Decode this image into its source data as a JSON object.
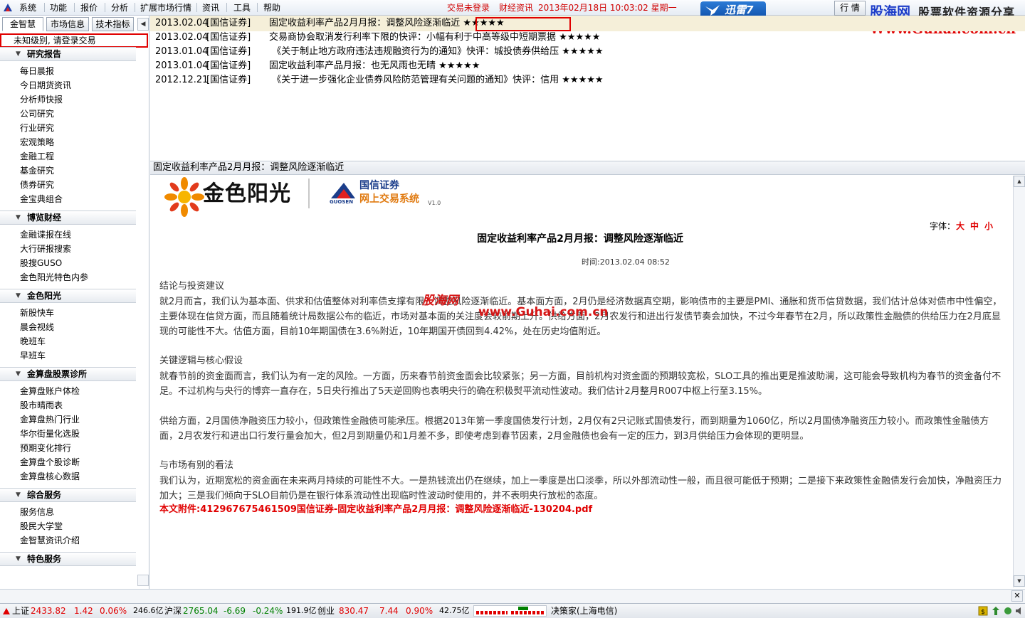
{
  "menubar": {
    "items": [
      "系统",
      "功能",
      "报价",
      "分析",
      "扩展市场行情",
      "资讯",
      "工具",
      "帮助"
    ],
    "login_status": "交易未登录",
    "fin_news": "财经资讯",
    "datetime": "2013年02月18日 10:03:02 星期一",
    "xunlei": "迅雷7",
    "hq_button": "行 情"
  },
  "watermark_top": {
    "site": "股海网",
    "slogan": "股票软件资源分享",
    "url": "Www.Guhai.com.cn"
  },
  "left_panel": {
    "tabs": [
      "金智慧",
      "市场信息",
      "技术指标"
    ],
    "login_prompt": "未知级别, 请登录交易",
    "sections": [
      {
        "title": "研究报告",
        "items": [
          "每日晨报",
          "今日期货资讯",
          "分析师快报",
          "公司研究",
          "行业研究",
          "宏观策略",
          "金融工程",
          "基金研究",
          "债券研究",
          "金宝典组合"
        ]
      },
      {
        "title": "博览财经",
        "items": [
          "金融谍报在线",
          "大行研报搜索",
          "股搜GUSO",
          "金色阳光特色内参"
        ]
      },
      {
        "title": "金色阳光",
        "items": [
          "新股快车",
          "晨会视线",
          "晚班车",
          "早班车"
        ]
      },
      {
        "title": "金算盘股票诊所",
        "items": [
          "金算盘账户体检",
          "股市晴雨表",
          "金算盘热门行业",
          "华尔街量化选股",
          "预期变化排行",
          "金算盘个股诊断",
          "金算盘核心数据"
        ]
      },
      {
        "title": "综合服务",
        "items": [
          "服务信息",
          "股民大学堂",
          "金智慧资讯介绍"
        ]
      },
      {
        "title": "特色服务",
        "items": []
      }
    ]
  },
  "news_list": [
    {
      "date": "2013.02.04",
      "source": "[国信证券]",
      "title": "固定收益利率产品2月月报：调整风险逐渐临近",
      "stars": "★★★★★"
    },
    {
      "date": "2013.02.04",
      "source": "[国信证券]",
      "title": "交易商协会取消发行利率下限的快评：小幅有利于中高等级中短期票据",
      "stars": "★★★★★"
    },
    {
      "date": "2013.01.04",
      "source": "[国信证券]",
      "title": " 《关于制止地方政府违法违规融资行为的通知》快评：城投债券供给压",
      "stars": "★★★★★"
    },
    {
      "date": "2013.01.04",
      "source": "[国信证券]",
      "title": "固定收益利率产品月报：也无风雨也无晴",
      "stars": "★★★★★"
    },
    {
      "date": "2012.12.21",
      "source": "[国信证券]",
      "title": " 《关于进一步强化企业债券风险防范管理有关问题的通知》快评：信用",
      "stars": "★★★★★"
    }
  ],
  "article": {
    "bar_title": "固定收益利率产品2月月报：调整风险逐渐临近",
    "brand": "金色阳光",
    "gs_name": "国信证券",
    "gs_en": "GUOSEN",
    "gs_system": "网上交易系统",
    "gs_version": "V1.0",
    "font_label": "字体：",
    "font_sizes": [
      "大",
      "中",
      "小"
    ],
    "title": "固定收益利率产品2月月报：调整风险逐渐临近",
    "time": "时间:2013.02.04 08:52",
    "sections": [
      {
        "head": "结论与投资建议",
        "text": "就2月而言，我们认为基本面、供求和估值整体对利率债支撑有限，调整风险逐渐临近。基本面方面，2月仍是经济数据真空期，影响债市的主要是PMI、通胀和货币信贷数据，我们估计总体对债市中性偏空，主要体现在信贷方面，而且随着统计局数据公布的临近，市场对基本面的关注度会较前期上升。供给方面，2月农发行和进出行发债节奏会加快，不过今年春节在2月，所以政策性金融债的供给压力在2月底显现的可能性不大。估值方面，目前10年期国债在3.6%附近，10年期国开债回到4.42%，处在历史均值附近。"
      },
      {
        "head": "关键逻辑与核心假设",
        "text": "就春节前的资金面而言，我们认为有一定的风险。一方面，历来春节前资金面会比较紧张；另一方面，目前机构对资金面的预期较宽松，SLO工具的推出更是推波助澜，这可能会导致机构为春节的资金备付不足。不过机构与央行的博弈一直存在，5日央行推出了5天逆回购也表明央行的确在积极熨平流动性波动。我们估计2月整月R007中枢上行至3.15%。"
      },
      {
        "head": "",
        "text": "供给方面，2月国债净融资压力较小，但政策性金融债可能承压。根据2013年第一季度国债发行计划，2月仅有2只记账式国债发行，而到期量为1060亿，所以2月国债净融资压力较小。而政策性金融债方面，2月农发行和进出口行发行量会加大，但2月到期量仍和1月差不多，即使考虑到春节因素，2月金融债也会有一定的压力，到3月供给压力会体现的更明显。"
      },
      {
        "head": "与市场有别的看法",
        "text": "我们认为，近期宽松的资金面在未来两月持续的可能性不大。一是热钱流出仍在继续，加上一季度是出口淡季，所以外部流动性一般，而且很可能低于预期；二是接下来政策性金融债发行会加快，净融资压力加大；三是我们倾向于SLO目前仍是在银行体系流动性出现临时性波动时使用的，并不表明央行放松的态度。"
      }
    ],
    "attachment": "本文附件:412967675461509国信证券-固定收益利率产品2月月报：调整风险逐渐临近-130204.pdf",
    "watermark_site": "股海网",
    "watermark_url": "www.Guhai.com.cn"
  },
  "statusbar": {
    "sh_label": "上证",
    "sh_value": "2433.82",
    "sh_change": "1.42",
    "sh_pct": "0.06%",
    "sh_amount": "246.6亿",
    "hs_label": "沪深",
    "hs_value": "2765.04",
    "hs_change": "-6.69",
    "hs_pct": "-0.24%",
    "hs_amount": "191.9亿",
    "cy_label": "创业",
    "cy_value": "830.47",
    "cy_change": "7.44",
    "cy_pct": "0.90%",
    "cy_amount": "42.75亿",
    "server": "决策家(上海电信)"
  },
  "colors": {
    "up": "#e00000",
    "down": "#008000",
    "highlight_border": "#e00000",
    "selected_row": "#f5efd9"
  }
}
